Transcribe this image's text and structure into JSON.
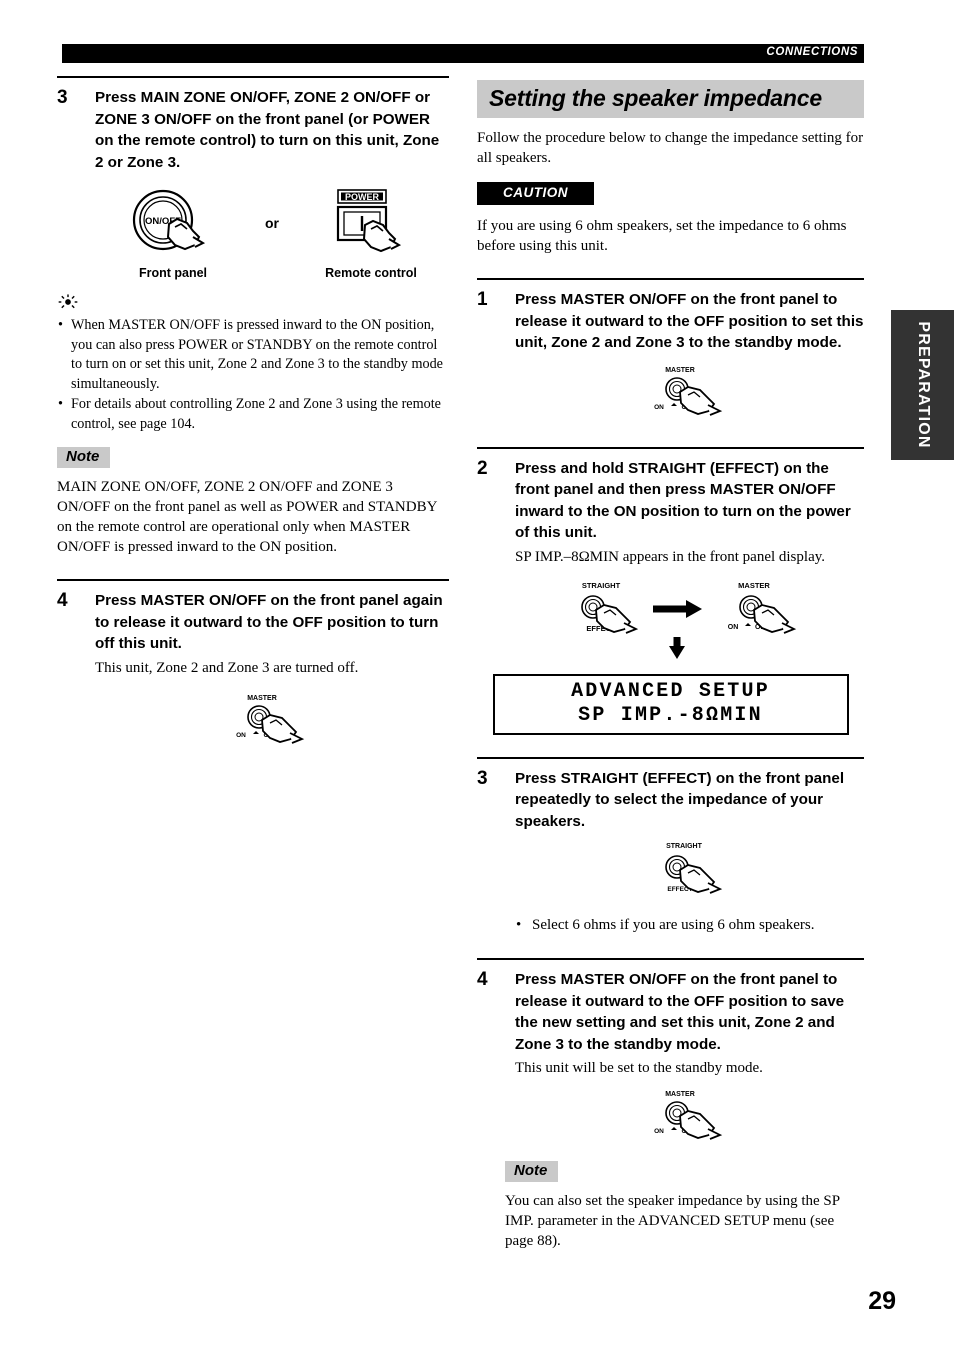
{
  "header": {
    "chapter_label": "CONNECTIONS"
  },
  "side_tab": {
    "label": "PREPARATION"
  },
  "page_number": "29",
  "left_column": {
    "step3": {
      "number": "3",
      "title": "Press MAIN ZONE ON/OFF, ZONE 2 ON/OFF or ZONE 3 ON/OFF on the front panel (or POWER on the remote control) to turn on this unit, Zone 2 or Zone 3.",
      "figure": {
        "front_panel_button_label": "ON/OFF",
        "front_panel_caption": "Front panel",
        "or_label": "or",
        "remote_button_tag": "POWER",
        "remote_button_symbol": "I",
        "remote_caption": "Remote control"
      }
    },
    "tips": [
      "When MASTER ON/OFF is pressed inward to the ON position, you can also press POWER or STANDBY on the remote control to turn on or set this unit, Zone 2 and Zone 3 to the standby mode simultaneously.",
      "For details about controlling Zone 2 and Zone 3 using the remote control, see page 104."
    ],
    "note": {
      "tag": "Note",
      "text": "MAIN ZONE ON/OFF, ZONE 2 ON/OFF and ZONE 3 ON/OFF on the front panel as well as POWER and STANDBY on the remote control are operational only when MASTER ON/OFF is pressed inward to the ON position."
    },
    "step4": {
      "number": "4",
      "title": "Press MASTER ON/OFF on the front panel again to release it outward to the OFF position to turn off this unit.",
      "sub": "This unit, Zone 2 and Zone 3 are turned off.",
      "figure": {
        "top_label": "MASTER",
        "left_label": "ON",
        "right_label": "OFF"
      }
    }
  },
  "right_column": {
    "section_title": "Setting the speaker impedance",
    "intro": "Follow the procedure below to change the impedance setting for all speakers.",
    "caution": {
      "label": "CAUTION",
      "text": "If you are using 6 ohm speakers, set the impedance to 6 ohms before using this unit."
    },
    "step1": {
      "number": "1",
      "title": "Press MASTER ON/OFF on the front panel to release it outward to the OFF position to set this unit, Zone 2 and Zone 3 to the standby mode.",
      "figure": {
        "top_label": "MASTER",
        "left_label": "ON",
        "right_label": "OFF"
      }
    },
    "step2": {
      "number": "2",
      "title": "Press and hold STRAIGHT (EFFECT) on the front panel and then press MASTER ON/OFF inward to the ON position to turn on the power of this unit.",
      "sub": "SP IMP.–8ΩMIN appears in the front panel display.",
      "figure": {
        "straight_top_label": "STRAIGHT",
        "straight_bottom_label": "EFFECT",
        "master_top_label": "MASTER",
        "master_left_label": "ON",
        "master_right_label": "OFF"
      },
      "display": {
        "line1": "ADVANCED SETUP",
        "line2": "SP IMP.-8ΩMIN"
      }
    },
    "step3": {
      "number": "3",
      "title": "Press STRAIGHT (EFFECT) on the front panel repeatedly to select the impedance of your speakers.",
      "figure": {
        "top_label": "STRAIGHT",
        "bottom_label": "EFFECT"
      },
      "bullets": [
        "Select 6 ohms if you are using 6 ohm speakers."
      ]
    },
    "step4": {
      "number": "4",
      "title": "Press MASTER ON/OFF on the front panel to release it outward to the OFF position to save the new setting and set this unit, Zone 2 and Zone 3 to the standby mode.",
      "sub": "This unit will be set to the standby mode.",
      "figure": {
        "top_label": "MASTER",
        "left_label": "ON",
        "right_label": "OFF"
      }
    },
    "note": {
      "tag": "Note",
      "text": "You can also set the speaker impedance by using the SP IMP. parameter in the ADVANCED SETUP menu (see page 88)."
    }
  },
  "colors": {
    "header_bar": "#000000",
    "section_head_bg": "#c9c9c9",
    "note_tag_bg": "#c9c9c9",
    "side_tab_bg": "#333333",
    "caution_bg": "#000000"
  }
}
